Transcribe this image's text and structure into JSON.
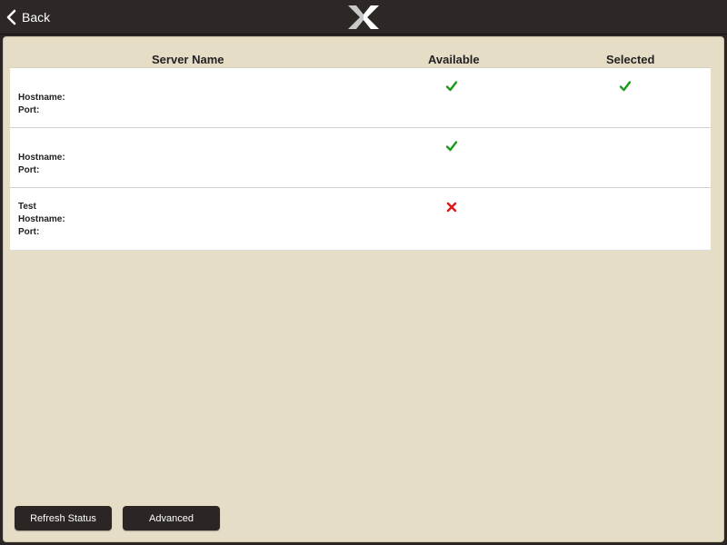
{
  "topbar": {
    "back_label": "Back",
    "logo_icon": "x-logo-icon"
  },
  "table": {
    "headers": {
      "server_name": "Server Name",
      "available": "Available",
      "selected": "Selected"
    },
    "rows": [
      {
        "name": "",
        "hostname_label": "Hostname:",
        "port_label": "Port:",
        "available": true,
        "selected": true
      },
      {
        "name": "",
        "hostname_label": "Hostname:",
        "port_label": "Port:",
        "available": true,
        "selected": false
      },
      {
        "name": "Test",
        "hostname_label": "Hostname:",
        "port_label": "Port:",
        "available": false,
        "selected": false
      }
    ]
  },
  "buttons": {
    "refresh_label": "Refresh Status",
    "advanced_label": "Advanced"
  },
  "colors": {
    "check": "#1a9a1a",
    "cross": "#d81e1e",
    "background": "#e6ddc7",
    "topbar": "#2d2825"
  }
}
